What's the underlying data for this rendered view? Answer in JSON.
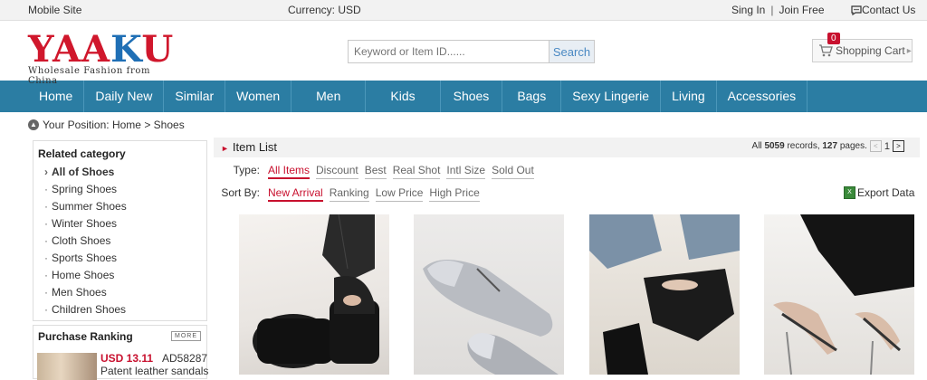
{
  "topbar": {
    "mobile": "Mobile Site",
    "currency": "Currency: USD",
    "sign_in": "Sing In",
    "separator": "|",
    "join": "Join Free",
    "contact": "Contact Us"
  },
  "header": {
    "logo_text_a": "YAA",
    "logo_text_b": "K",
    "logo_text_c": "U",
    "logo_tagline": "Wholesale Fashion from China",
    "search_placeholder": "Keyword or Item ID......",
    "search_button": "Search",
    "cart_count": "0",
    "cart_label": "Shopping Cart"
  },
  "nav": [
    "Home",
    "Daily New",
    "Similar",
    "Women",
    "Men",
    "Kids",
    "Shoes",
    "Bags",
    "Sexy Lingerie",
    "Living",
    "Accessories"
  ],
  "breadcrumb": {
    "label": "Your Position:",
    "home": "Home",
    "sep": ">",
    "current": "Shoes"
  },
  "sidebar": {
    "title": "Related category",
    "items": [
      "All of Shoes",
      "Spring Shoes",
      "Summer Shoes",
      "Winter Shoes",
      "Cloth Shoes",
      "Sports Shoes",
      "Home Shoes",
      "Men Shoes",
      "Children Shoes"
    ]
  },
  "ranking": {
    "title": "Purchase Ranking",
    "more": "MORE",
    "price": "USD 13.11",
    "code": "AD58287",
    "name": "Patent leather sandals"
  },
  "list": {
    "title": "Item List",
    "stats_prefix": "All",
    "records": "5059",
    "records_suffix": "records,",
    "pages": "127",
    "pages_suffix": "pages.",
    "current_page": "1",
    "type_label": "Type:",
    "types": [
      "All Items",
      "Discount",
      "Best",
      "Real Shot",
      "Intl Size",
      "Sold Out"
    ],
    "sort_label": "Sort By:",
    "sorts": [
      "New Arrival",
      "Ranking",
      "Low Price",
      "High Price"
    ],
    "export": "Export Data"
  },
  "colors": {
    "nav_bg": "#2b7da3",
    "accent_red": "#c8102e",
    "logo_blue": "#1f6fb5"
  }
}
